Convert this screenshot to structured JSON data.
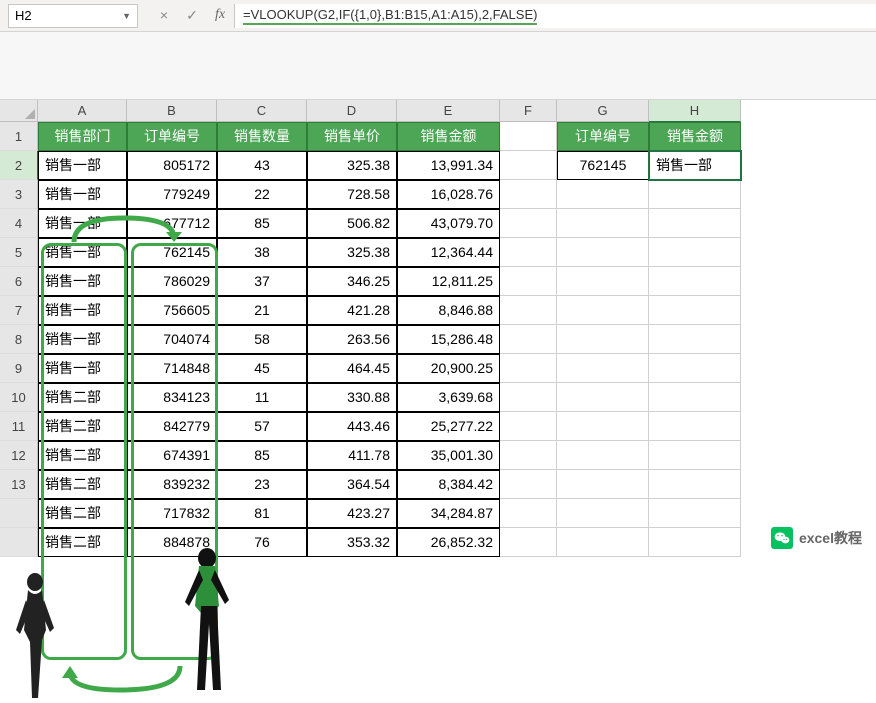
{
  "name_box": "H2",
  "formula": "=VLOOKUP(G2,IF({1,0},B1:B15,A1:A15),2,FALSE)",
  "columns": [
    "A",
    "B",
    "C",
    "D",
    "E",
    "F",
    "G",
    "H"
  ],
  "row_numbers": [
    "1",
    "2",
    "3",
    "4",
    "5",
    "6",
    "7",
    "8",
    "9",
    "10",
    "11",
    "12",
    "13"
  ],
  "headers": {
    "A": "销售部门",
    "B": "订单编号",
    "C": "销售数量",
    "D": "销售单价",
    "E": "销售金额",
    "G": "订单编号",
    "H": "销售金额"
  },
  "lookup": {
    "order": "762145",
    "result": "销售一部"
  },
  "chart_data": {
    "type": "table",
    "columns": [
      "销售部门",
      "订单编号",
      "销售数量",
      "销售单价",
      "销售金额"
    ],
    "rows": [
      {
        "dept": "销售一部",
        "order": "805172",
        "qty": "43",
        "price": "325.38",
        "amt": "13,991.34"
      },
      {
        "dept": "销售一部",
        "order": "779249",
        "qty": "22",
        "price": "728.58",
        "amt": "16,028.76"
      },
      {
        "dept": "销售一部",
        "order": "677712",
        "qty": "85",
        "price": "506.82",
        "amt": "43,079.70"
      },
      {
        "dept": "销售一部",
        "order": "762145",
        "qty": "38",
        "price": "325.38",
        "amt": "12,364.44"
      },
      {
        "dept": "销售一部",
        "order": "786029",
        "qty": "37",
        "price": "346.25",
        "amt": "12,811.25"
      },
      {
        "dept": "销售一部",
        "order": "756605",
        "qty": "21",
        "price": "421.28",
        "amt": "8,846.88"
      },
      {
        "dept": "销售一部",
        "order": "704074",
        "qty": "58",
        "price": "263.56",
        "amt": "15,286.48"
      },
      {
        "dept": "销售一部",
        "order": "714848",
        "qty": "45",
        "price": "464.45",
        "amt": "20,900.25"
      },
      {
        "dept": "销售二部",
        "order": "834123",
        "qty": "11",
        "price": "330.88",
        "amt": "3,639.68"
      },
      {
        "dept": "销售二部",
        "order": "842779",
        "qty": "57",
        "price": "443.46",
        "amt": "25,277.22"
      },
      {
        "dept": "销售二部",
        "order": "674391",
        "qty": "85",
        "price": "411.78",
        "amt": "35,001.30"
      },
      {
        "dept": "销售二部",
        "order": "839232",
        "qty": "23",
        "price": "364.54",
        "amt": "8,384.42"
      },
      {
        "dept": "销售二部",
        "order": "717832",
        "qty": "81",
        "price": "423.27",
        "amt": "34,284.87"
      },
      {
        "dept": "销售二部",
        "order": "884878",
        "qty": "76",
        "price": "353.32",
        "amt": "26,852.32"
      }
    ]
  },
  "watermark": "excel教程",
  "icons": {
    "cancel": "×",
    "confirm": "✓",
    "fx": "fx",
    "dropdown": "▼"
  }
}
